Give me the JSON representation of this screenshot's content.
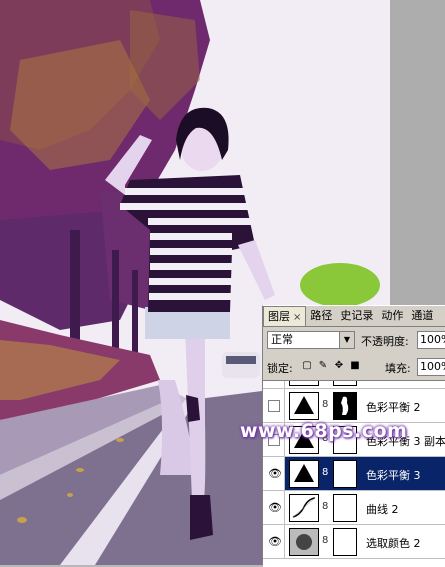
{
  "watermark": "www.68ps.com",
  "panel": {
    "tabs": [
      {
        "label": "图层",
        "close": "×"
      },
      {
        "label": "路径"
      },
      {
        "label": "史记录"
      },
      {
        "label": "动作"
      },
      {
        "label": "通道"
      }
    ],
    "blend_mode": "正常",
    "opacity_label": "不透明度:",
    "opacity_value": "100%",
    "lock_label": "锁定:",
    "fill_label": "填充:",
    "fill_value": "100%",
    "layers": [
      {
        "name": "色彩平衡 2",
        "visible": false,
        "selected": false
      },
      {
        "name": "色彩平衡 3 副本",
        "visible": false,
        "selected": false
      },
      {
        "name": "色彩平衡 3",
        "visible": true,
        "selected": true
      },
      {
        "name": "曲线 2",
        "visible": true,
        "selected": false
      },
      {
        "name": "选取颜色 2",
        "visible": true,
        "selected": false
      }
    ]
  },
  "icons": {
    "eye": "eye-icon",
    "chain": "link-chain-icon",
    "lock_transparent": "lock-transparent-icon",
    "lock_paint": "brush-icon",
    "lock_move": "move-icon",
    "lock_all": "lock-icon"
  },
  "colors": {
    "foliage": "#6b2a6e",
    "foliage_light": "#a56a3a",
    "road": "#7d6f8c",
    "selection": "#0a246a"
  }
}
